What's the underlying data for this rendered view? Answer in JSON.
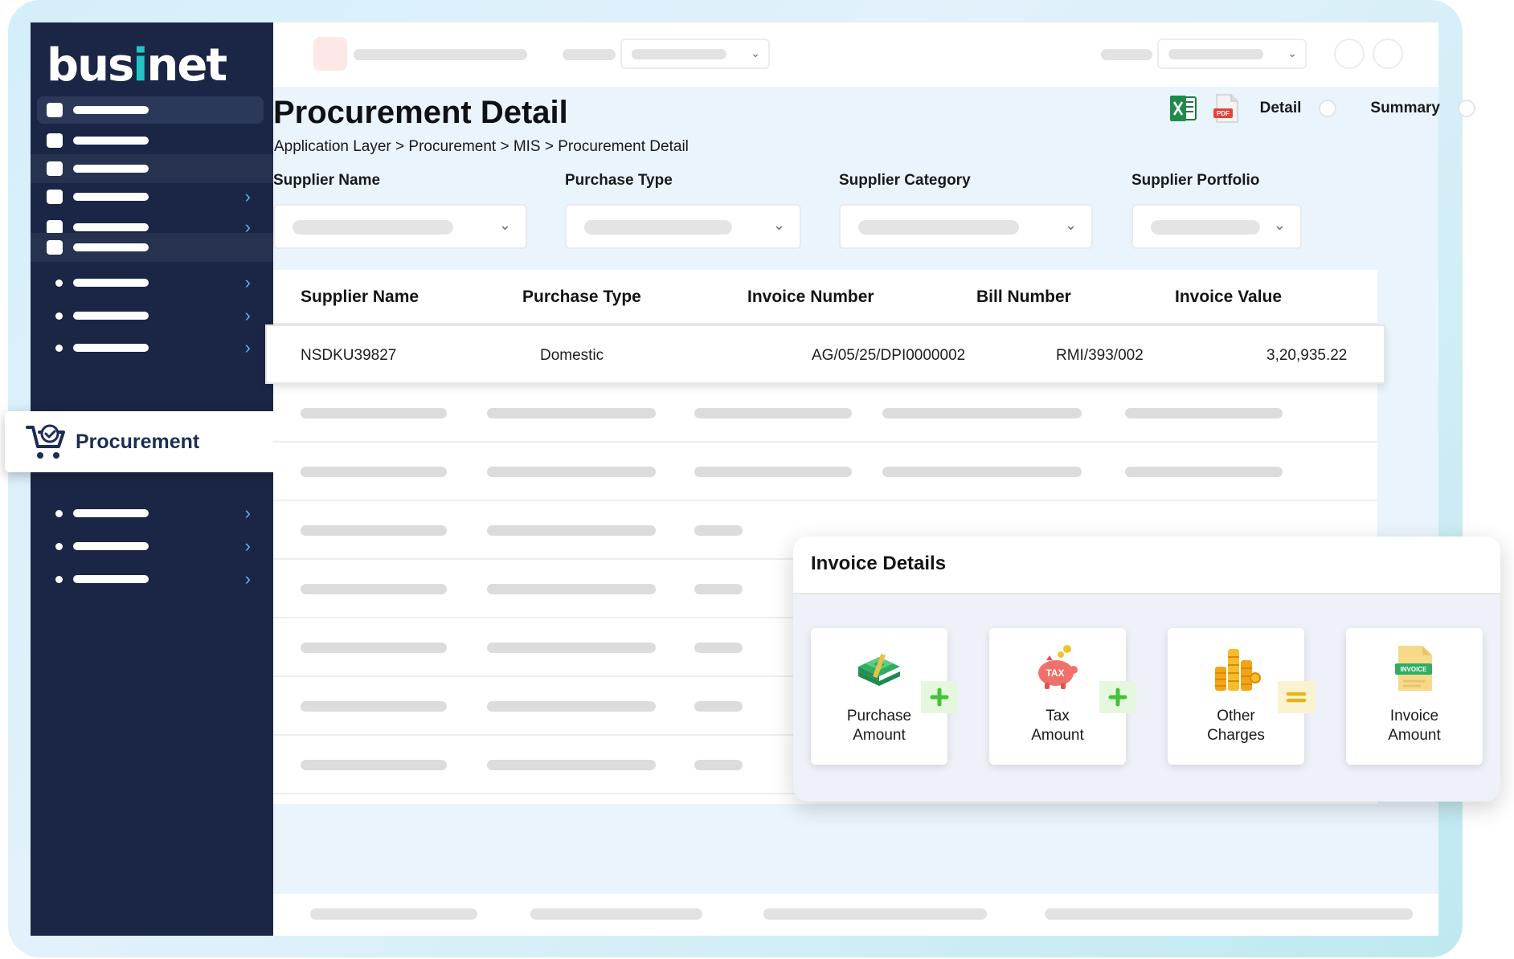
{
  "app": {
    "logo": {
      "prefix": "bus",
      "i": "i",
      "suffix": "net"
    }
  },
  "sidebar": {
    "active_module": "Procurement"
  },
  "header": {
    "title": "Procurement Detail",
    "breadcrumb": "Application Layer > Procurement > MIS > Procurement Detail"
  },
  "view_options": {
    "excel_icon": "excel-icon",
    "pdf_icon": "pdf-icon",
    "pdf_badge": "PDF",
    "detail_label": "Detail",
    "summary_label": "Summary",
    "detail_selected": false,
    "summary_selected": false
  },
  "filters": [
    {
      "label": "Supplier Name"
    },
    {
      "label": "Purchase Type"
    },
    {
      "label": "Supplier Category"
    },
    {
      "label": "Supplier Portfolio"
    }
  ],
  "table": {
    "columns": [
      "Supplier Name",
      "Purchase Type",
      "Invoice Number",
      "Bill Number",
      "Invoice Value"
    ],
    "rows": [
      [
        "NSDKU39827",
        "Domestic",
        "AG/05/25/DPI0000002",
        "RMI/393/002",
        "3,20,935.22"
      ]
    ]
  },
  "invoice_details": {
    "title": "Invoice Details",
    "items": [
      {
        "label_line1": "Purchase",
        "label_line2": "Amount",
        "icon": "money-stack-icon"
      },
      {
        "label_line1": "Tax",
        "label_line2": "Amount",
        "icon": "tax-piggy-icon"
      },
      {
        "label_line1": "Other",
        "label_line2": "Charges",
        "icon": "coin-stacks-icon"
      },
      {
        "label_line1": "Invoice",
        "label_line2": "Amount",
        "icon": "invoice-document-icon"
      }
    ],
    "icon_texts": {
      "tax": "TAX",
      "invoice": "INVOICE"
    },
    "operators": [
      "+",
      "+",
      "="
    ],
    "colors": {
      "plus": "#43c23a",
      "equals": "#e4b51b"
    }
  },
  "colors": {
    "sidebar_bg": "#1b2646",
    "accent_teal": "#20c5c6",
    "chevron": "#5ab6e4",
    "brand_navy": "#1b2d55"
  }
}
